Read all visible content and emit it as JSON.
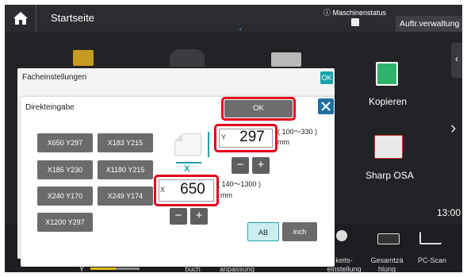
{
  "topbar": {
    "title": "Startseite",
    "status": "ⓘ Maschinenstatus",
    "job_status": "Auftr.verwaltung"
  },
  "home_tiles": {
    "copy_label": "Kopieren",
    "sharp_osa_label": "Sharp OSA",
    "clock": "13:00",
    "bottom": [
      "buch",
      "anpassung",
      "keits-\neinstellung",
      "Gesamtzä\nhlung",
      "PC-Scan"
    ],
    "toner_label": "Y"
  },
  "dialog_tray": {
    "title": "Facheinstellungen",
    "ok_label": "OK"
  },
  "dialog_direct": {
    "title": "Direkteingabe",
    "ok_label": "OK",
    "presets": [
      "X650 Y297",
      "X183 Y215",
      "X185 Y230",
      "X1180 Y215",
      "X240 Y170",
      "X249 Y174",
      "X1200 Y297"
    ],
    "y_field": {
      "prefix": "Y",
      "value": "297",
      "range": "( 100～330 )",
      "unit": "mm"
    },
    "x_field": {
      "prefix": "X",
      "value": "650",
      "range": "( 140～1300 )",
      "unit": "mm"
    },
    "axis_x_label": "X",
    "minus": "−",
    "plus": "+",
    "unit_ab": "AB",
    "unit_inch": "inch"
  },
  "colors": {
    "accent": "#1aa2aa",
    "highlight": "#e3001b",
    "button_gray": "#6b6b6b"
  }
}
